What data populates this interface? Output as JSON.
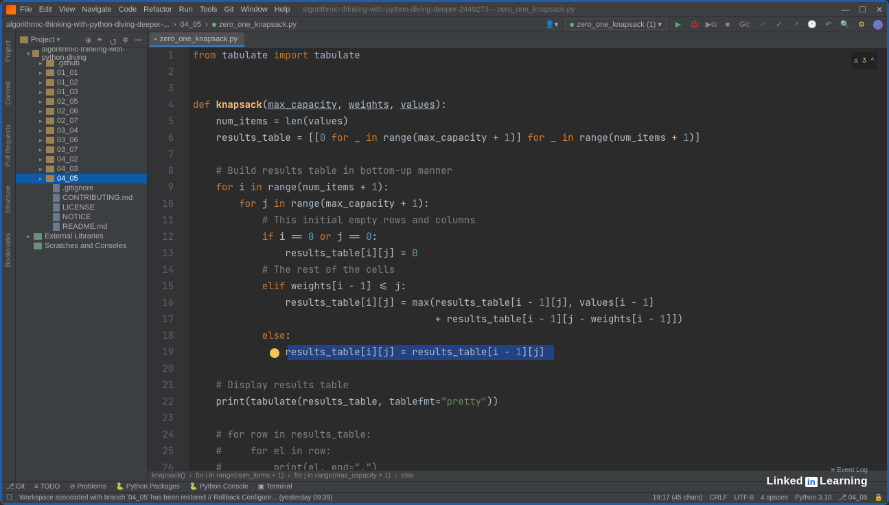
{
  "window_title": "algorithmic-thinking-with-python-diving-deeper-2449273 – zero_one_knapsack.py",
  "menu": [
    "File",
    "Edit",
    "View",
    "Navigate",
    "Code",
    "Refactor",
    "Run",
    "Tools",
    "Git",
    "Window",
    "Help"
  ],
  "nav_crumbs": [
    "algorithmic-thinking-with-python-diving-deeper-...",
    "04_05",
    "zero_one_knapsack.py"
  ],
  "run_config_label": "zero_one_knapsack (1)",
  "git_label": "Git:",
  "project_label": "Project",
  "tree": {
    "root": "algorithmic-thinking-with-python-diving",
    "folders": [
      ".github",
      "01_01",
      "01_02",
      "01_03",
      "02_05",
      "02_06",
      "02_07",
      "03_04",
      "03_06",
      "03_07",
      "04_02",
      "04_03",
      "04_05"
    ],
    "selected_folder": "04_05",
    "files": [
      ".gitignore",
      "CONTRIBUTING.md",
      "LICENSE",
      "NOTICE",
      "README.md"
    ],
    "external": "External Libraries",
    "scratches": "Scratches and Consoles"
  },
  "tab_label": "zero_one_knapsack.py",
  "inspections": {
    "warn": "⚠ 3",
    "hint": "^"
  },
  "code_lines": [
    {
      "n": 1,
      "html": "<span class='kw'>from</span> <span class='nm'>tabulate</span> <span class='kw'>import</span> <span class='nm'>tabulate</span>"
    },
    {
      "n": 2,
      "html": ""
    },
    {
      "n": 3,
      "html": ""
    },
    {
      "n": 4,
      "html": "<span class='kw'>def</span> <span class='fn'>knapsack</span>(<span class='nm' style='text-decoration:underline'>max_capacity</span>, <span class='nm' style='text-decoration:underline'>weights</span>, <span class='nm' style='text-decoration:underline'>values</span>):"
    },
    {
      "n": 5,
      "html": "    num_items = <span class='nm'>len</span>(values)"
    },
    {
      "n": 6,
      "html": "    results_table = [[<span class='num'>0</span> <span class='kw'>for</span> _ <span class='kw'>in</span> <span class='nm'>range</span>(max_capacity + <span class='num'>1</span>)] <span class='kw'>for</span> _ <span class='kw'>in</span> <span class='nm'>range</span>(num_items + <span class='num'>1</span>)]"
    },
    {
      "n": 7,
      "html": ""
    },
    {
      "n": 8,
      "html": "    <span class='cm'># Build results table in bottom-up manner</span>"
    },
    {
      "n": 9,
      "html": "    <span class='kw'>for</span> i <span class='kw'>in</span> <span class='nm'>range</span>(num_items + <span class='num'>1</span>):"
    },
    {
      "n": 10,
      "html": "        <span class='kw'>for</span> j <span class='kw'>in</span> <span class='nm'>range</span>(max_capacity + <span class='num'>1</span>):"
    },
    {
      "n": 11,
      "html": "            <span class='cm'># This initial empty rows and columns</span>"
    },
    {
      "n": 12,
      "html": "            <span class='kw'>if</span> i == <span class='num'>0</span> <span class='kw'>or</span> j == <span class='num'>0</span>:"
    },
    {
      "n": 13,
      "html": "                results_table[i][j] = <span class='num'>0</span>"
    },
    {
      "n": 14,
      "html": "            <span class='cm'># The rest of the cells</span>"
    },
    {
      "n": 15,
      "html": "            <span class='kw'>elif</span> weights[i - <span class='num'>1</span>] &lt;= j:"
    },
    {
      "n": 16,
      "html": "                results_table[i][j] = <span class='nm'>max</span>(results_table[i - <span class='num'>1</span>][j], values[i - <span class='num'>1</span>]"
    },
    {
      "n": 17,
      "html": "                                          + results_table[i - <span class='num'>1</span>][j - weights[i - <span class='num'>1</span>]])"
    },
    {
      "n": 18,
      "html": "            <span class='kw'>else</span>:"
    },
    {
      "n": 19,
      "html": "                <span class='selection' style='left:138px;width:388px;height:22px;top:1px;'></span><span style='position:relative'><span class='bulb'></span>results_table[i][j] = results_table[i - <span class='num'>1</span>][j]</span>"
    },
    {
      "n": 20,
      "html": ""
    },
    {
      "n": 21,
      "html": "    <span class='cm'># Display results table</span>"
    },
    {
      "n": 22,
      "html": "    <span class='nm'>print</span>(tabulate(results_table, <span class='nm'>tablefmt</span>=<span class='str'>\"pretty\"</span>))"
    },
    {
      "n": 23,
      "html": ""
    },
    {
      "n": 24,
      "html": "    <span class='cm'># for row in results_table:</span>"
    },
    {
      "n": 25,
      "html": "    <span class='cm'>#     for el in row:</span>"
    },
    {
      "n": 26,
      "html": "    <span class='cm'>#         print(el, end=\",\")</span>"
    }
  ],
  "breadcrumb": [
    "knapsack()",
    "for i in range(num_items + 1)",
    "for j in range(max_capacity + 1)",
    "else"
  ],
  "bottom_tools": {
    "git": "Git",
    "todo": "TODO",
    "problems": "Problems",
    "packages": "Python Packages",
    "console": "Python Console",
    "terminal": "Terminal"
  },
  "status": {
    "msg": "Workspace associated with branch '04_05' has been restored // Rollback  Configure...  (yesterday 09:39)",
    "pos": "19:17 (45 chars)",
    "eol": "CRLF",
    "enc": "UTF-8",
    "indent": "4 spaces",
    "interp": "Python 3.10",
    "branch": "04_05"
  },
  "left_strip": [
    "Project",
    "Commit",
    "Pull Requests",
    "Structure",
    "Bookmarks"
  ],
  "watermark": {
    "brand": "Linked",
    "in": "in",
    "suffix": "Learning"
  },
  "event_log": "Event Log"
}
